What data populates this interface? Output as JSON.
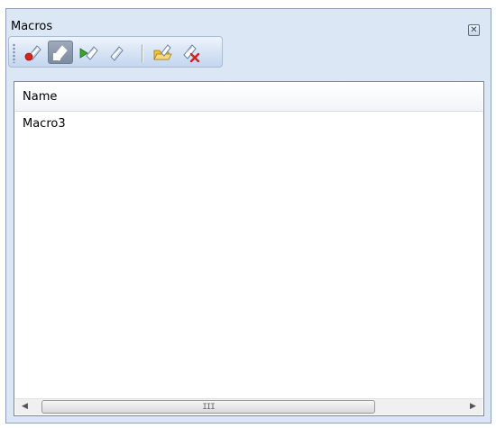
{
  "window": {
    "title": "Macros",
    "close_icon": "close-icon"
  },
  "toolbar": {
    "buttons": [
      {
        "name": "record-macro-button",
        "icon": "record-macro-icon",
        "pressed": false
      },
      {
        "name": "stop-recording-button",
        "icon": "stop-recording-icon",
        "pressed": true
      },
      {
        "name": "run-macro-button",
        "icon": "run-macro-icon",
        "pressed": false
      },
      {
        "name": "load-macro-button",
        "icon": "load-macro-icon",
        "pressed": false
      },
      {
        "name": "delete-macro-button",
        "icon": "delete-macro-icon",
        "pressed": false
      }
    ]
  },
  "list": {
    "column_header": "Name",
    "rows": [
      {
        "name": "Macro3"
      }
    ]
  },
  "scrollbar": {
    "thumb_grip": "III"
  },
  "colors": {
    "panel_bg": "#dce7f5",
    "record_red": "#d9221c",
    "run_green": "#3aa629",
    "folder_yellow": "#f0c040",
    "delete_red": "#d42020"
  }
}
